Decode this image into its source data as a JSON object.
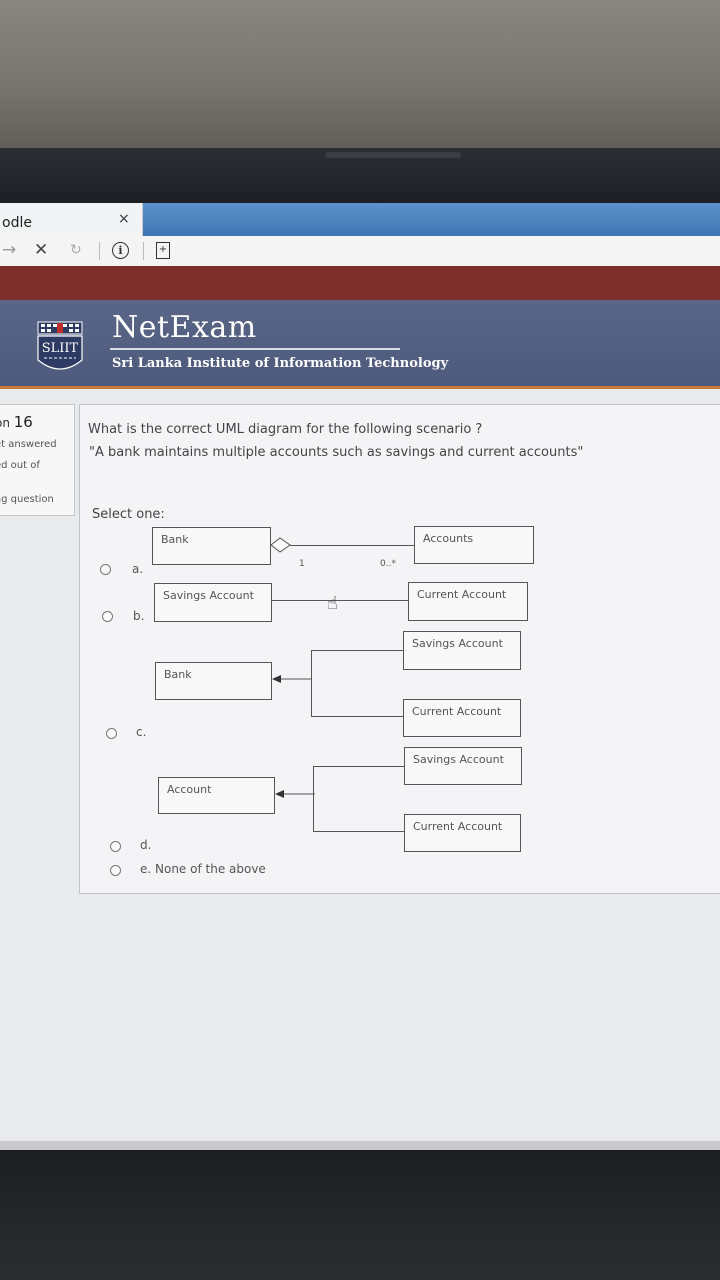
{
  "browser": {
    "tab_title": "odle",
    "tab_close": "×",
    "nav_back": "→",
    "nav_stop": "✕",
    "nav_reload": "↻"
  },
  "site": {
    "brand": "NetExam",
    "subtitle": "Sri Lanka Institute of Information Technology",
    "logo_text": "SLIIT"
  },
  "question_info": {
    "number_prefix": "on ",
    "number": "16",
    "status": "et answered",
    "marked": "ed out of",
    "flag": "ag question"
  },
  "question": {
    "text": "What is the correct UML diagram for the following scenario ?",
    "scenario": "\"A bank maintains multiple accounts such as savings and current accounts\"",
    "select_one": "Select one:"
  },
  "options": {
    "a": {
      "label": "a.",
      "left_box": "Bank",
      "right_box": "Accounts",
      "mult_left": "1",
      "mult_right": "0..*"
    },
    "b": {
      "label": "b.",
      "left_box": "Savings Account",
      "right_box": "Current Account"
    },
    "c": {
      "label": "c.",
      "parent": "Bank",
      "child_top": "Savings Account",
      "child_bottom": "Current Account"
    },
    "d": {
      "label": "d.",
      "parent": "Account",
      "child_top": "Savings Account",
      "child_bottom": "Current Account"
    },
    "e": {
      "label": "e. None of the above"
    }
  },
  "colors": {
    "header_bg": "#56628a",
    "accent_red": "#7c2f2b",
    "accent_orange": "#c97a3a",
    "tab_blue": "#4a80bd"
  }
}
